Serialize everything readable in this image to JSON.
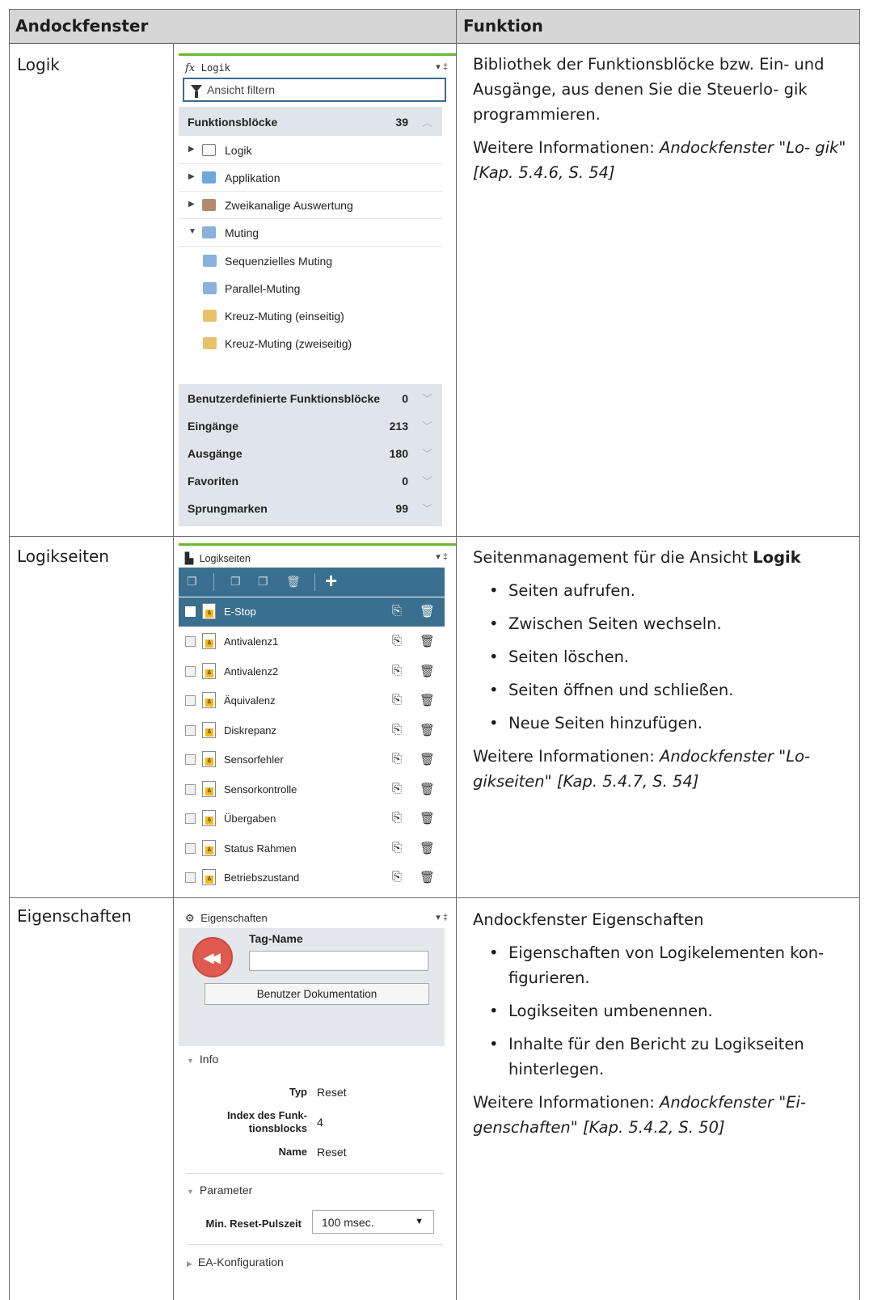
{
  "table": {
    "col1_header": "Andockfenster",
    "col2_header": "Funktion"
  },
  "rows": [
    {
      "label": "Logik",
      "panel": {
        "title": "Logik",
        "filter_placeholder": "Ansicht filtern",
        "groups_top": {
          "label": "Funktionsblöcke",
          "count": "39"
        },
        "tree": [
          "Logik",
          "Applikation",
          "Zweikanalige Auswertung",
          "Muting"
        ],
        "muting_items": [
          "Sequenzielles Muting",
          "Parallel-Muting",
          "Kreuz-Muting (einseitig)",
          "Kreuz-Muting (zweiseitig)"
        ],
        "groups_bottom": [
          {
            "label": "Benutzerdefinierte Funktionsblöcke",
            "count": "0"
          },
          {
            "label": "Eingänge",
            "count": "213"
          },
          {
            "label": "Ausgänge",
            "count": "180"
          },
          {
            "label": "Favoriten",
            "count": "0"
          },
          {
            "label": "Sprungmarken",
            "count": "99"
          }
        ]
      },
      "function": {
        "p1": "Bibliothek der Funktionsblöcke bzw. Ein- und Ausgänge, aus denen Sie die Steuerlo- gik programmieren.",
        "more_prefix": "Weitere Informationen: ",
        "more_ref": "Andockfenster \"Lo- gik\" [Kap. 5.4.6, S. 54]"
      }
    },
    {
      "label": "Logikseiten",
      "panel": {
        "title": "Logikseiten",
        "pages": [
          "E-Stop",
          "Antivalenz1",
          "Antivalenz2",
          "Äquivalenz",
          "Diskrepanz",
          "Sensorfehler",
          "Sensorkontrolle",
          "Übergaben",
          "Status Rahmen",
          "Betriebszustand"
        ],
        "selected_page": "E-Stop"
      },
      "function": {
        "intro": "Seitenmanagement für die Ansicht ",
        "intro_bold": "Logik",
        "bullets": [
          "Seiten aufrufen.",
          "Zwischen Seiten wechseln.",
          "Seiten löschen.",
          "Seiten öffnen und schließen.",
          "Neue Seiten hinzufügen."
        ],
        "more_prefix": "Weitere Informationen: ",
        "more_ref": "Andockfenster \"Lo- gikseiten\" [Kap. 5.4.7, S. 54]"
      }
    },
    {
      "label": "Eigenschaften",
      "panel": {
        "title": "Eigenschaften",
        "tag_name_label": "Tag-Name",
        "tag_name_value": "",
        "doc_button": "Benutzer Dokumentation",
        "info_section": "Info",
        "info": [
          {
            "key": "Typ",
            "value": "Reset"
          },
          {
            "key": "Index des Funk- tionsblocks",
            "value": "4"
          },
          {
            "key": "Name",
            "value": "Reset"
          }
        ],
        "param_section": "Parameter",
        "param_key": "Min. Reset-Pulszeit",
        "param_value": "100 msec.",
        "ea_section": "EA-Konfiguration"
      },
      "function": {
        "intro": "Andockfenster Eigenschaften",
        "bullets": [
          "Eigenschaften von Logikelementen kon- figurieren.",
          "Logikseiten umbenennen.",
          "Inhalte für den Bericht zu Logikseiten hinterlegen."
        ],
        "more_prefix": "Weitere Informationen: ",
        "more_ref": "Andockfenster \"Ei- genschaften\" [Kap. 5.4.2, S. 50]"
      }
    }
  ]
}
